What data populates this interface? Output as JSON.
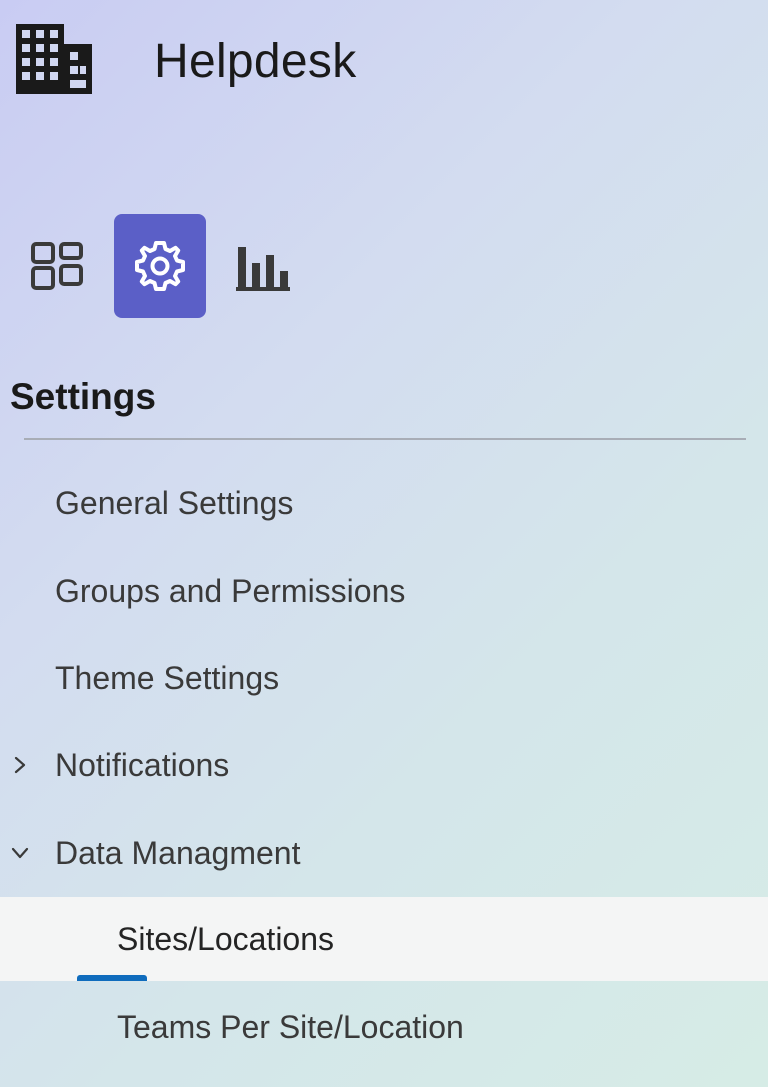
{
  "app": {
    "title": "Helpdesk",
    "icon": "building-icon"
  },
  "nav_rail": [
    {
      "name": "apps-icon",
      "active": false
    },
    {
      "name": "gear-icon",
      "active": true
    },
    {
      "name": "bar-chart-icon",
      "active": false
    }
  ],
  "colors": {
    "accent": "#5b5fc7",
    "selected_indicator": "#0f6cbd",
    "selected_row_bg": "#f4f5f5"
  },
  "section": {
    "title": "Settings"
  },
  "menu": {
    "general": "General Settings",
    "groups": "Groups and Permissions",
    "theme": "Theme Settings",
    "notifications": "Notifications",
    "data_management": "Data Managment",
    "sites": "Sites/Locations",
    "teams": "Teams Per Site/Location"
  }
}
